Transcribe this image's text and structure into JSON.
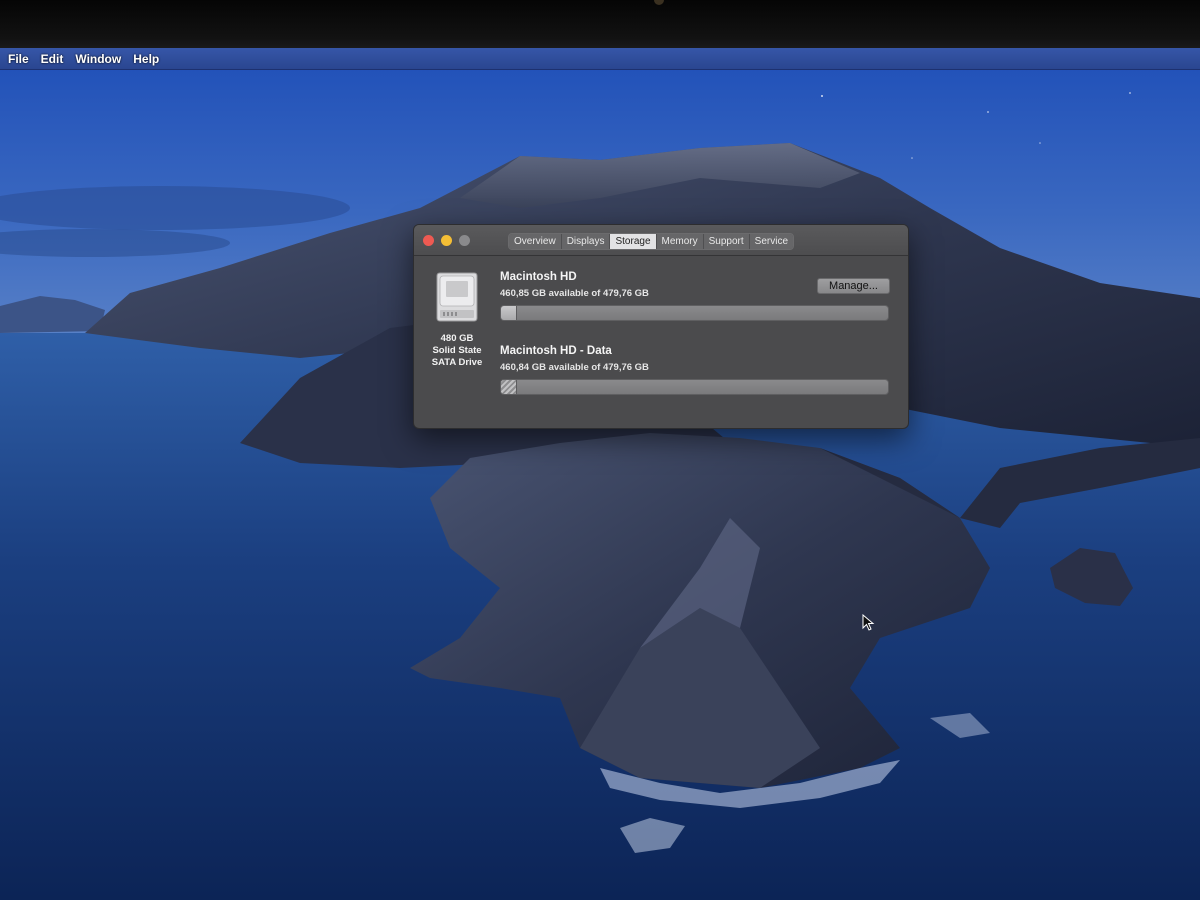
{
  "menubar": {
    "items": [
      "File",
      "Edit",
      "Window",
      "Help"
    ]
  },
  "window": {
    "tabs": [
      {
        "label": "Overview",
        "active": false
      },
      {
        "label": "Displays",
        "active": false
      },
      {
        "label": "Storage",
        "active": true
      },
      {
        "label": "Memory",
        "active": false
      },
      {
        "label": "Support",
        "active": false
      },
      {
        "label": "Service",
        "active": false
      }
    ],
    "drive": {
      "icon": "hard-drive-icon",
      "capacity": "480 GB",
      "type_line1": "Solid State",
      "type_line2": "SATA Drive"
    },
    "manage_label": "Manage...",
    "volumes": [
      {
        "name": "Macintosh HD",
        "available": "460,85 GB available of 479,76 GB",
        "used_fraction": 0.04,
        "pattern": "plain"
      },
      {
        "name": "Macintosh HD - Data",
        "available": "460,84 GB available of 479,76 GB",
        "used_fraction": 0.04,
        "pattern": "striped"
      }
    ]
  },
  "colors": {
    "close": "#ee5a52",
    "minimize": "#f4be35",
    "zoom_inactive": "#8a8a8c",
    "window_bg": "#4b4b4d"
  }
}
